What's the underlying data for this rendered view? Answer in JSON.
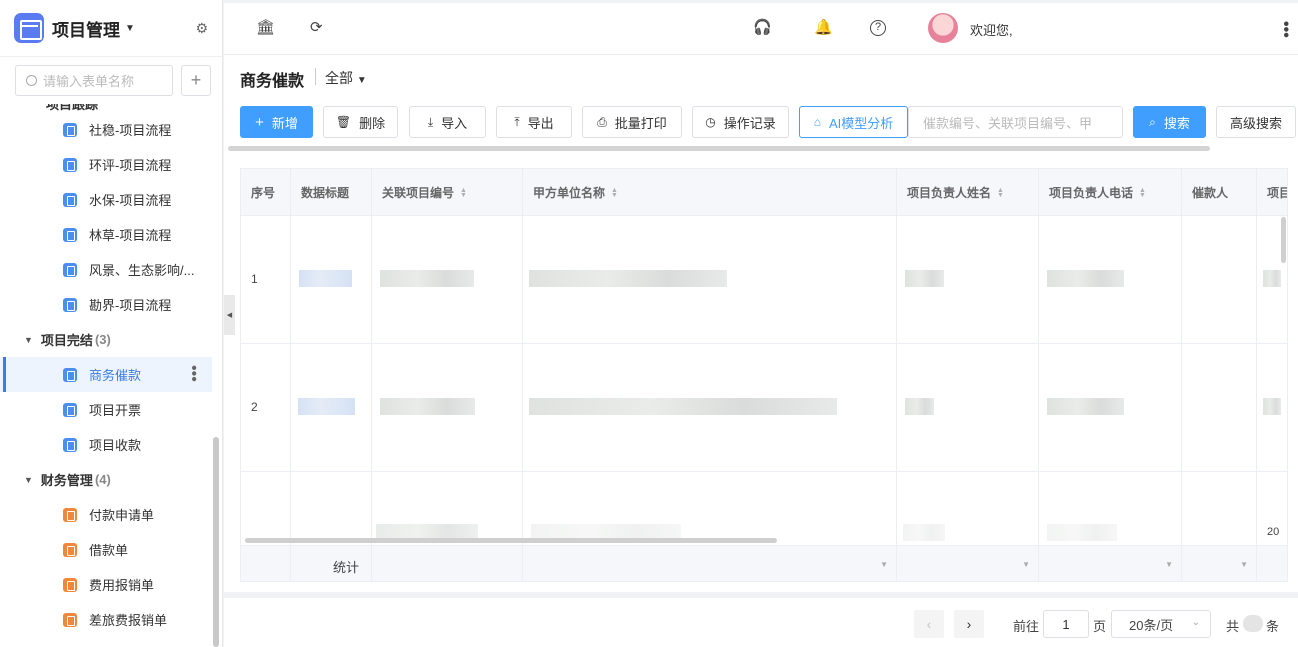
{
  "sidebar": {
    "app_title": "项目管理",
    "search_placeholder": "请输入表单名称",
    "cut_group_label": "项目跟踪",
    "items_top": [
      {
        "label": "社稳-项目流程"
      },
      {
        "label": "环评-项目流程"
      },
      {
        "label": "水保-项目流程"
      },
      {
        "label": "林草-项目流程"
      },
      {
        "label": "风景、生态影响/..."
      },
      {
        "label": "勘界-项目流程"
      }
    ],
    "group_completion": {
      "label": "项目完结",
      "count": "(3)"
    },
    "items_completion": [
      {
        "label": "商务催款"
      },
      {
        "label": "项目开票"
      },
      {
        "label": "项目收款"
      }
    ],
    "group_finance": {
      "label": "财务管理",
      "count": "(4)"
    },
    "items_finance": [
      {
        "label": "付款申请单"
      },
      {
        "label": "借款单"
      },
      {
        "label": "费用报销单"
      },
      {
        "label": "差旅费报销单"
      }
    ]
  },
  "topbar": {
    "welcome": "欢迎您,"
  },
  "page": {
    "title": "商务催款",
    "scope": "全部"
  },
  "toolbar": {
    "add": "新增",
    "delete": "删除",
    "import": "导入",
    "export": "导出",
    "batch_print": "批量打印",
    "op_log": "操作记录",
    "ai_analysis": "AI模型分析",
    "search_placeholder": "催款编号、关联项目编号、甲",
    "search": "搜索",
    "advanced_search": "高级搜索"
  },
  "table": {
    "columns": [
      "序号",
      "数据标题",
      "关联项目编号",
      "甲方单位名称",
      "项目负责人姓名",
      "项目负责人电话",
      "催款人",
      "项目"
    ],
    "rows": [
      {
        "index": "1"
      },
      {
        "index": "2"
      }
    ],
    "footer_label": "统计",
    "partial_value": "20"
  },
  "pagination": {
    "goto_label": "前往",
    "page_value": "1",
    "page_unit": "页",
    "page_size": "20条/页",
    "total_prefix": "共",
    "total_suffix": "条"
  },
  "colors": {
    "primary": "#409eff",
    "sidebar_active": "#3a7be8",
    "file_icon_blue": "#4a8ff0",
    "file_icon_orange": "#f0873a"
  }
}
